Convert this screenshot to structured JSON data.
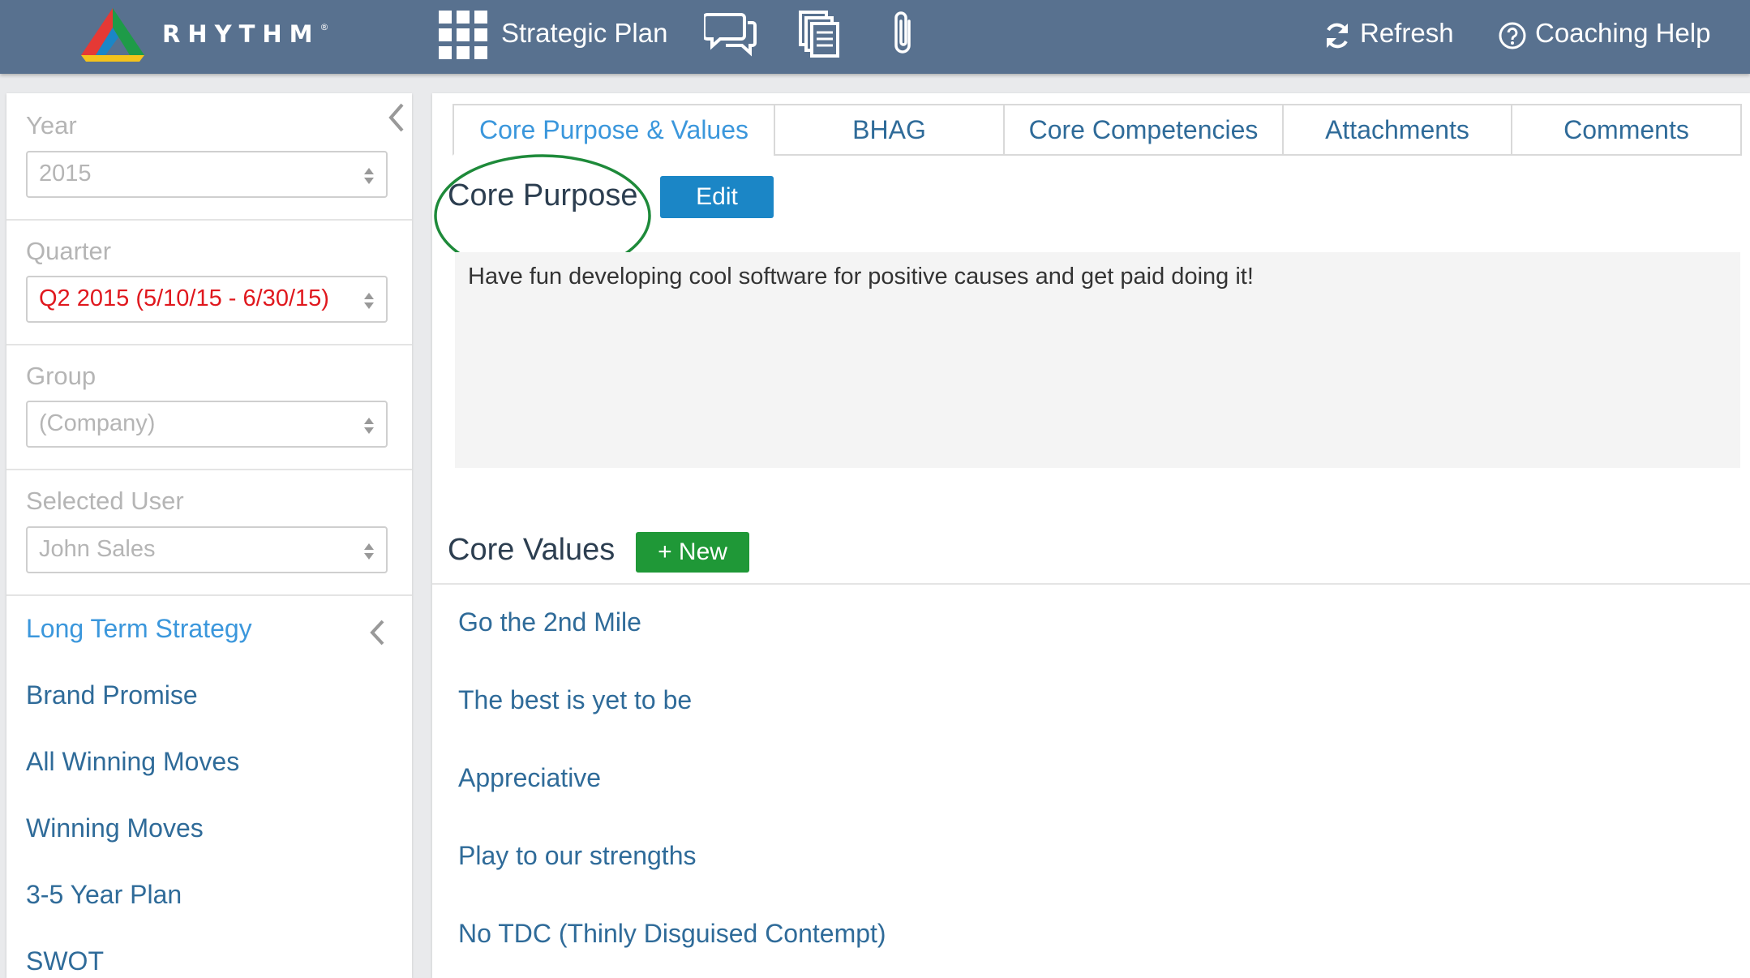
{
  "app": {
    "brand": "RHYTHM",
    "brand_mark": "®",
    "brand_colors": [
      "#e53935",
      "#1e9b48",
      "#f4c31b",
      "#1b86c6"
    ]
  },
  "topnav": {
    "strategic_plan_label": "Strategic Plan",
    "refresh_label": "Refresh",
    "coaching_help_label": "Coaching Help",
    "icons": [
      "apps-grid-icon",
      "comments-icon",
      "documents-icon",
      "paperclip-icon",
      "refresh-icon",
      "help-circle-icon"
    ]
  },
  "sidebar": {
    "filters": [
      {
        "label": "Year",
        "value": "2015",
        "highlight": false
      },
      {
        "label": "Quarter",
        "value": "Q2 2015 (5/10/15 - 6/30/15)",
        "highlight": true
      },
      {
        "label": "Group",
        "value": "(Company)",
        "highlight": false
      },
      {
        "label": "Selected User",
        "value": "John Sales",
        "highlight": false
      }
    ],
    "nav": [
      {
        "label": "Long Term Strategy",
        "active": true
      },
      {
        "label": "Brand Promise",
        "active": false
      },
      {
        "label": "All Winning Moves",
        "active": false
      },
      {
        "label": "Winning Moves",
        "active": false
      },
      {
        "label": "3-5 Year Plan",
        "active": false
      },
      {
        "label": "SWOT",
        "active": false
      }
    ]
  },
  "main": {
    "tabs": [
      {
        "label": "Core Purpose & Values",
        "active": true
      },
      {
        "label": "BHAG",
        "active": false
      },
      {
        "label": "Core Competencies",
        "active": false
      },
      {
        "label": "Attachments",
        "active": false
      },
      {
        "label": "Comments",
        "active": false
      }
    ],
    "core_purpose": {
      "title": "Core Purpose",
      "edit_label": "Edit",
      "text": "Have fun developing cool software for positive causes and get paid doing it!",
      "highlight_color": "#1e8a3a"
    },
    "core_values": {
      "title": "Core Values",
      "new_label": "+ New",
      "items": [
        "Go the 2nd Mile",
        "The best is yet to be",
        "Appreciative",
        "Play to our strengths",
        "No TDC (Thinly Disguised Contempt)"
      ]
    }
  }
}
